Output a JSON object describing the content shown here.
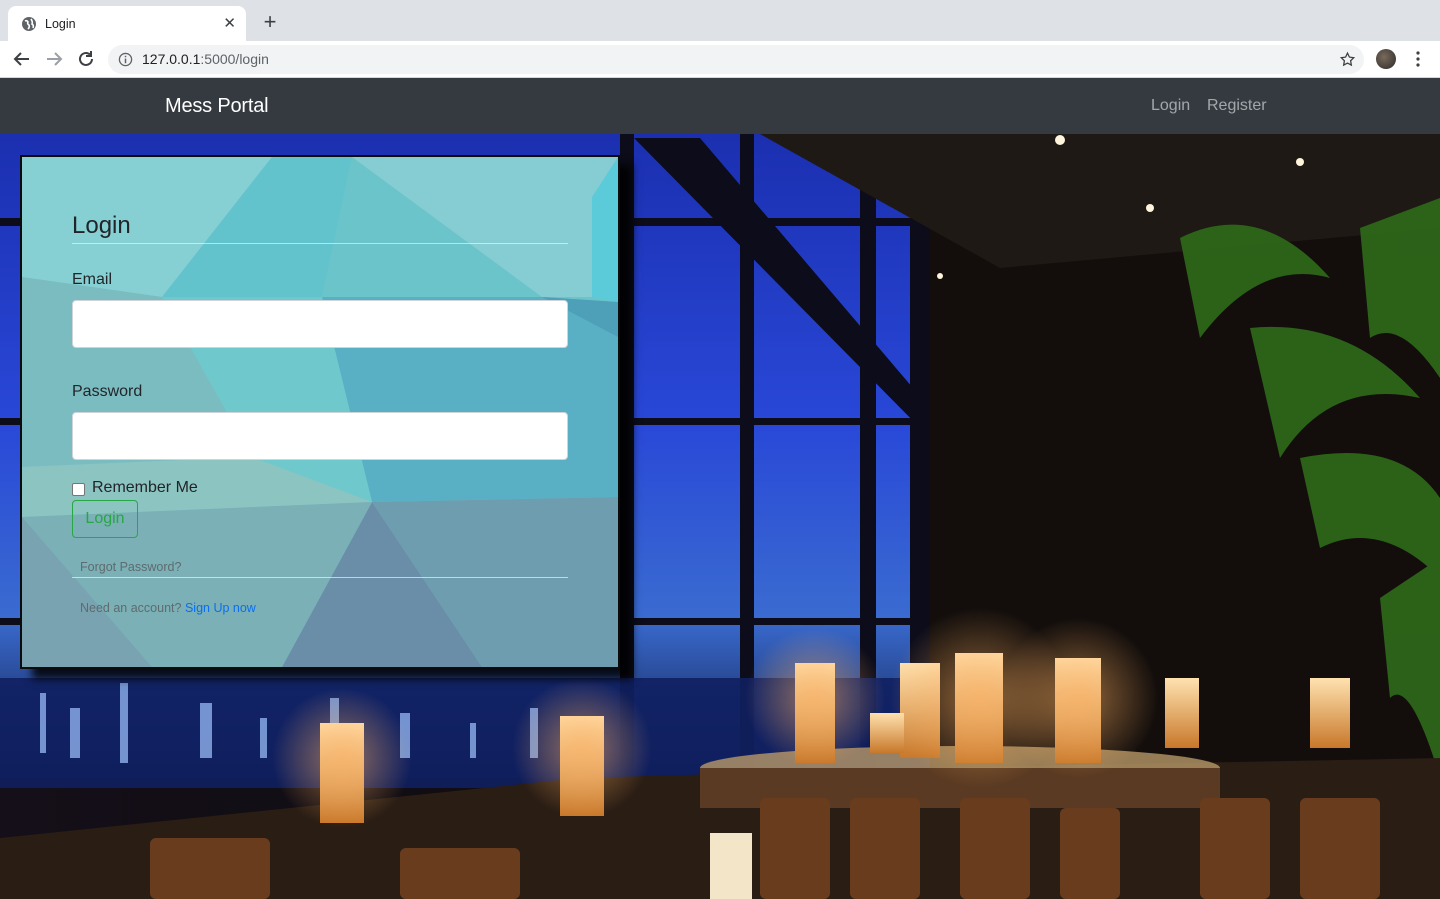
{
  "browser": {
    "tab_title": "Login",
    "url_host": "127.0.0.1",
    "url_path": ":5000/login"
  },
  "site": {
    "brand": "Mess Portal",
    "nav": [
      "Login",
      "Register"
    ]
  },
  "form": {
    "title": "Login",
    "email_label": "Email",
    "email_value": "",
    "password_label": "Password",
    "password_value": "",
    "remember_label": "Remember Me",
    "remember_checked": false,
    "submit_label": "Login",
    "forgot_label": "Forgot Password?",
    "need_account_text": "Need an account?",
    "signup_label": "Sign Up now"
  },
  "colors": {
    "navbar": "#343a40",
    "success": "#28a745",
    "link": "#0a6ff0",
    "card_teal": "#6fc7cf"
  },
  "icons": [
    "globe-icon",
    "close-icon",
    "plus-icon",
    "back-arrow-icon",
    "forward-arrow-icon",
    "reload-icon",
    "info-icon",
    "star-icon",
    "avatar",
    "kebab-menu-icon"
  ]
}
